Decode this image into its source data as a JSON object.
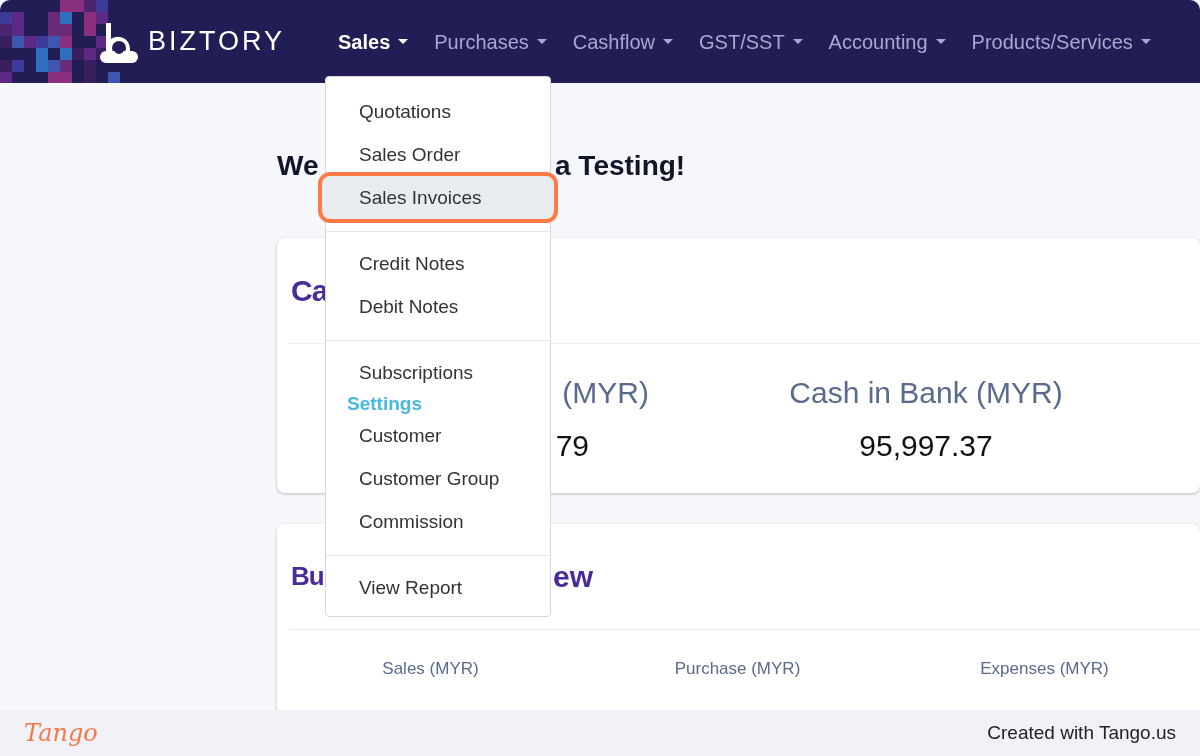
{
  "navbar": {
    "brand": "BIZTORY",
    "items": [
      {
        "label": "Sales",
        "selected": true
      },
      {
        "label": "Purchases",
        "selected": false
      },
      {
        "label": "Cashflow",
        "selected": false
      },
      {
        "label": "GST/SST",
        "selected": false
      },
      {
        "label": "Accounting",
        "selected": false
      },
      {
        "label": "Products/Services",
        "selected": false
      }
    ]
  },
  "dropdown": {
    "items": [
      {
        "kind": "item",
        "label": "Quotations",
        "selected": false
      },
      {
        "kind": "item",
        "label": "Sales Order",
        "selected": false
      },
      {
        "kind": "item",
        "label": "Sales Invoices",
        "selected": true
      },
      {
        "kind": "divider"
      },
      {
        "kind": "item",
        "label": "Credit Notes",
        "selected": false
      },
      {
        "kind": "item",
        "label": "Debit Notes",
        "selected": false
      },
      {
        "kind": "divider"
      },
      {
        "kind": "item",
        "label": "Subscriptions",
        "selected": false
      },
      {
        "kind": "header",
        "label": "Settings"
      },
      {
        "kind": "item",
        "label": "Customer",
        "selected": false
      },
      {
        "kind": "item",
        "label": "Customer Group",
        "selected": false
      },
      {
        "kind": "item",
        "label": "Commission",
        "selected": false
      },
      {
        "kind": "divider"
      },
      {
        "kind": "item",
        "label": "View Report",
        "selected": false
      }
    ]
  },
  "greeting": {
    "before": "We",
    "after": "a Testing!"
  },
  "cash_card": {
    "title": "Ca",
    "stats": [
      {
        "label": "(MYR)",
        "value": "79"
      },
      {
        "label": "Cash in Bank (MYR)",
        "value": "95,997.37"
      }
    ]
  },
  "overview_card": {
    "title_before": "Bu",
    "title_after": "ew",
    "columns": [
      "Sales (MYR)",
      "Purchase (MYR)",
      "Expenses (MYR)"
    ]
  },
  "footer": {
    "brand": "Tango",
    "credit": "Created with Tango.us"
  }
}
